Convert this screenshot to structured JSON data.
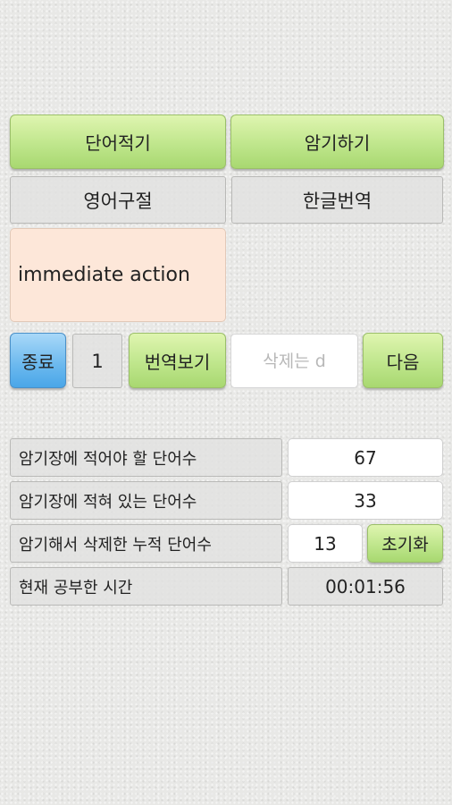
{
  "top_buttons": {
    "write_words": "단어적기",
    "memorize": "암기하기"
  },
  "headers": {
    "english_phrase": "영어구절",
    "korean_translation": "한글번역"
  },
  "phrase": {
    "english": "immediate action",
    "korean": ""
  },
  "controls": {
    "exit": "종료",
    "index": "1",
    "show_translation": "번역보기",
    "delete_placeholder": "삭제는 d",
    "next": "다음"
  },
  "stats": {
    "words_to_write_label": "암기장에 적어야 할 단어수",
    "words_to_write_value": "67",
    "words_written_label": "암기장에 적혀 있는 단어수",
    "words_written_value": "33",
    "deleted_label": "암기해서 삭제한 누적 단어수",
    "deleted_value": "13",
    "reset": "초기화",
    "time_label": "현재 공부한 시간",
    "time_value": "00:01:56"
  }
}
